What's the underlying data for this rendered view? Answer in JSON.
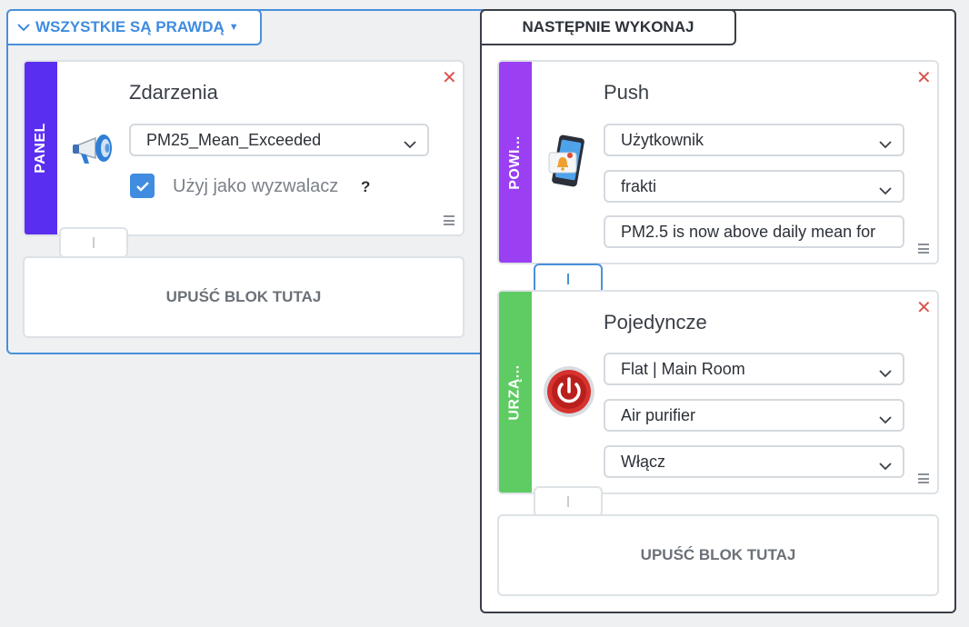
{
  "condition_group": {
    "operator_label": "WSZYSTKIE SĄ PRAWDĄ",
    "event_block": {
      "stripe_label": "PANEL",
      "stripe_color": "#5a2ef0",
      "icon": "megaphone-icon",
      "title": "Zdarzenia",
      "event_select": "PM25_Mean_Exceeded",
      "use_as_trigger_label": "Użyj jako wyzwalacz",
      "use_as_trigger_checked": true,
      "help": "?"
    },
    "drop_label": "UPUŚĆ BLOK TUTAJ"
  },
  "action_group": {
    "header": "NASTĘPNIE WYKONAJ",
    "push_block": {
      "stripe_label": "POWI...",
      "stripe_color": "#9a3ff2",
      "icon": "phone-notification-icon",
      "title": "Push",
      "recipient_type": "Użytkownik",
      "recipient": "frakti",
      "message": "PM2.5 is now above daily mean for"
    },
    "device_block": {
      "stripe_label": "URZĄ...",
      "stripe_color": "#5fcb63",
      "icon": "power-button-icon",
      "title": "Pojedyncze",
      "location": "Flat | Main Room",
      "device": "Air purifier",
      "command": "Włącz"
    },
    "drop_label": "UPUŚĆ BLOK TUTAJ"
  },
  "colors": {
    "accent_blue": "#3f8ce0",
    "delete_red": "#d9534f"
  }
}
